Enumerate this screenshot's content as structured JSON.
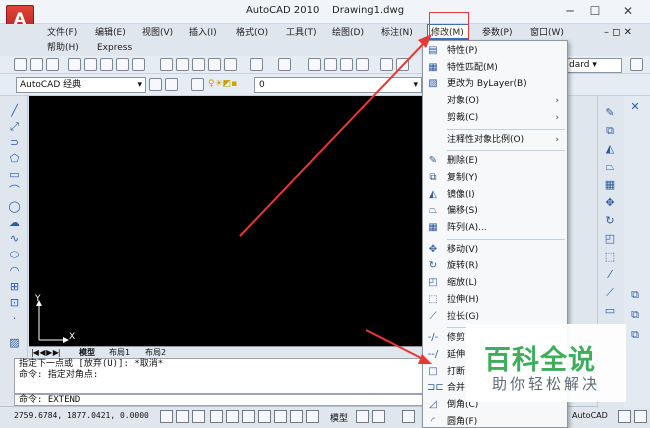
{
  "app": {
    "title": "AutoCAD 2010",
    "document": "Drawing1.dwg",
    "logo": "A"
  },
  "window_controls": {
    "minimize": "─",
    "maximize": "☐",
    "close": "✕"
  },
  "menubar": {
    "items": [
      "文件(F)",
      "编辑(E)",
      "视图(V)",
      "插入(I)",
      "格式(O)",
      "工具(T)",
      "绘图(D)",
      "标注(N)",
      "修改(M)",
      "参数(P)",
      "窗口(W)"
    ],
    "row2": [
      "帮助(H)",
      "Express"
    ],
    "right_controls": "– ◻ ✕"
  },
  "toolbar": {
    "workspace": "AutoCAD 经典",
    "layer": "0",
    "text_style_partial": "dard"
  },
  "tabs": {
    "nav": "|◀ ◀ ▶ ▶|",
    "model": "模型",
    "layout1": "布局1",
    "layout2": "布局2"
  },
  "ucs": {
    "y": "Y",
    "x": "X"
  },
  "command": {
    "lines": [
      "指定下一点或 [放弃(U)]: *取消*",
      "命令: 指定对角点:"
    ],
    "input": "命令: EXTEND"
  },
  "status": {
    "coords": "2759.6784, 1877.0421, 0.0000",
    "model": "模型",
    "annot": "AutoCAD"
  },
  "modify_menu": {
    "items": [
      {
        "icon": "properties-icon",
        "glyph": "▤",
        "label": "特性(P)"
      },
      {
        "icon": "match-properties-icon",
        "glyph": "▦",
        "label": "特性匹配(M)"
      },
      {
        "icon": "bylayer-icon",
        "glyph": "▧",
        "label": "更改为 ByLayer(B)"
      },
      {
        "icon": "",
        "glyph": "",
        "label": "对象(O)",
        "submenu": "›"
      },
      {
        "icon": "",
        "glyph": "",
        "label": "剪裁(C)",
        "submenu": "›"
      },
      {
        "sep": true
      },
      {
        "icon": "",
        "glyph": "",
        "label": "注释性对象比例(O)",
        "submenu": "›"
      },
      {
        "sep": true
      },
      {
        "icon": "erase-icon",
        "glyph": "✎",
        "label": "删除(E)"
      },
      {
        "icon": "copy-icon",
        "glyph": "⧉",
        "label": "复制(Y)"
      },
      {
        "icon": "mirror-icon",
        "glyph": "◭",
        "label": "镜像(I)"
      },
      {
        "icon": "offset-icon",
        "glyph": "⏢",
        "label": "偏移(S)"
      },
      {
        "icon": "array-icon",
        "glyph": "▦",
        "label": "阵列(A)..."
      },
      {
        "sep": true
      },
      {
        "icon": "move-icon",
        "glyph": "✥",
        "label": "移动(V)"
      },
      {
        "icon": "rotate-icon",
        "glyph": "↻",
        "label": "旋转(R)"
      },
      {
        "icon": "scale-icon",
        "glyph": "◰",
        "label": "缩放(L)"
      },
      {
        "icon": "stretch-icon",
        "glyph": "⬚",
        "label": "拉伸(H)"
      },
      {
        "icon": "lengthen-icon",
        "glyph": "⟋",
        "label": "拉长(G)"
      },
      {
        "sep": true
      },
      {
        "icon": "trim-icon",
        "glyph": "-/-",
        "label": "修剪"
      },
      {
        "icon": "extend-icon",
        "glyph": "--/",
        "label": "延伸"
      },
      {
        "icon": "break-icon",
        "glyph": "□",
        "label": "打断"
      },
      {
        "icon": "join-icon",
        "glyph": "⊐⊏",
        "label": "合并"
      },
      {
        "icon": "chamfer-icon",
        "glyph": "◿",
        "label": "倒角(C)"
      },
      {
        "icon": "fillet-icon",
        "glyph": "◜",
        "label": "圆角(F)"
      }
    ]
  },
  "watermark": {
    "line1": "百科全说",
    "line2": "助你轻松解决"
  },
  "colors": {
    "accent": "#3d6fb6",
    "annotation": "#e53935",
    "watermark_green": "#3fae5b"
  }
}
